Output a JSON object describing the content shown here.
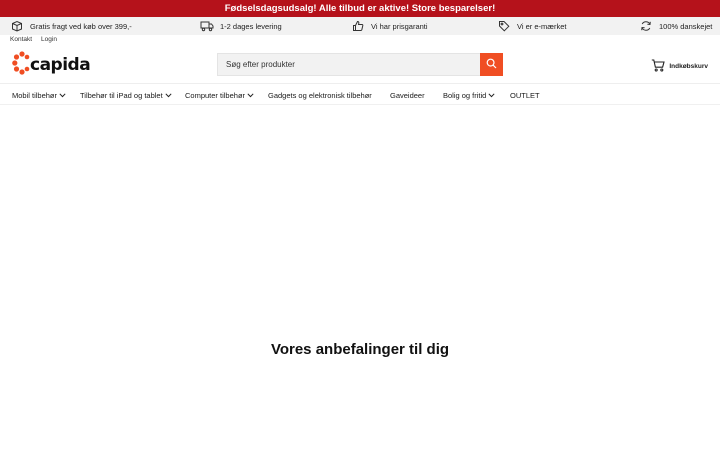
{
  "promo": {
    "text": "Fødselsdagsudsalg! Alle tilbud er aktive! Store besparelser!"
  },
  "usps": [
    {
      "icon": "box-icon",
      "text": "Gratis fragt ved køb over 399,-"
    },
    {
      "icon": "truck-icon",
      "text": "1-2 dages levering"
    },
    {
      "icon": "thumbs-up-icon",
      "text": "Vi har prisgaranti"
    },
    {
      "icon": "tag-icon",
      "text": "Vi er e-mærket"
    },
    {
      "icon": "refresh-icon",
      "text": "100% danskejet"
    }
  ],
  "account": {
    "contact": "Kontakt",
    "login": "Login"
  },
  "logo": {
    "text": "capida",
    "color": "#f04e23"
  },
  "search": {
    "placeholder": "Søg efter produkter",
    "button_color": "#f04e23"
  },
  "cart": {
    "label": "Indkøbskurv"
  },
  "nav": [
    {
      "label": "Mobil tilbehør",
      "has_dropdown": true
    },
    {
      "label": "Tilbehør til iPad og tablet",
      "has_dropdown": true
    },
    {
      "label": "Computer tilbehør",
      "has_dropdown": true
    },
    {
      "label": "Gadgets og elektronisk tilbehør",
      "has_dropdown": false
    },
    {
      "label": "Gaveideer",
      "has_dropdown": false
    },
    {
      "label": "Bolig og fritid",
      "has_dropdown": true
    },
    {
      "label": "OUTLET",
      "has_dropdown": false
    }
  ],
  "main": {
    "recommend_title": "Vores anbefalinger til dig"
  },
  "colors": {
    "promo_bg": "#b5121b",
    "usp_bg": "#f2f2f2",
    "accent": "#f04e23"
  }
}
